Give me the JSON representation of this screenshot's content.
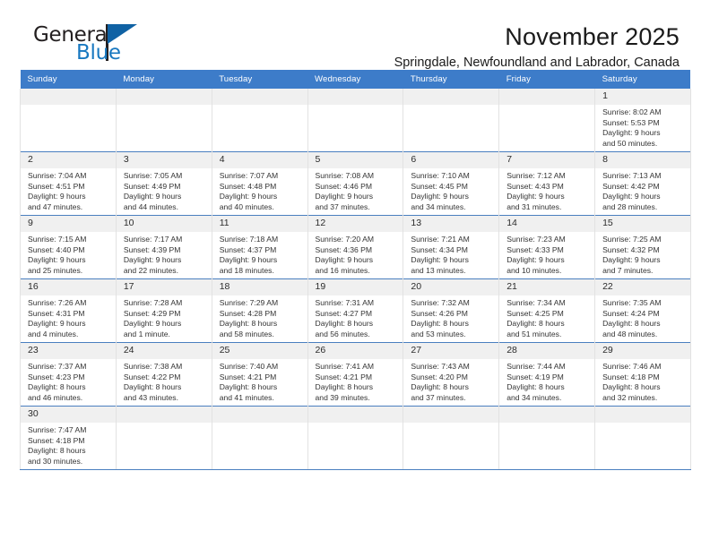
{
  "brand": {
    "name_top": "General",
    "name_bottom": "Blue",
    "accent_color": "#1878c0",
    "triangle_color": "#1062a4"
  },
  "header": {
    "title": "November 2025",
    "subtitle": "Springdale, Newfoundland and Labrador, Canada"
  },
  "calendar": {
    "header_bg": "#3d7cc9",
    "header_text_color": "#ffffff",
    "daynum_bg": "#f0f0f0",
    "row_separator_color": "#4a7fbf",
    "weekdays": [
      "Sunday",
      "Monday",
      "Tuesday",
      "Wednesday",
      "Thursday",
      "Friday",
      "Saturday"
    ],
    "weeks": [
      [
        {
          "day": "",
          "lines": []
        },
        {
          "day": "",
          "lines": []
        },
        {
          "day": "",
          "lines": []
        },
        {
          "day": "",
          "lines": []
        },
        {
          "day": "",
          "lines": []
        },
        {
          "day": "",
          "lines": []
        },
        {
          "day": "1",
          "lines": [
            "Sunrise: 8:02 AM",
            "Sunset: 5:53 PM",
            "Daylight: 9 hours",
            "and 50 minutes."
          ]
        }
      ],
      [
        {
          "day": "2",
          "lines": [
            "Sunrise: 7:04 AM",
            "Sunset: 4:51 PM",
            "Daylight: 9 hours",
            "and 47 minutes."
          ]
        },
        {
          "day": "3",
          "lines": [
            "Sunrise: 7:05 AM",
            "Sunset: 4:49 PM",
            "Daylight: 9 hours",
            "and 44 minutes."
          ]
        },
        {
          "day": "4",
          "lines": [
            "Sunrise: 7:07 AM",
            "Sunset: 4:48 PM",
            "Daylight: 9 hours",
            "and 40 minutes."
          ]
        },
        {
          "day": "5",
          "lines": [
            "Sunrise: 7:08 AM",
            "Sunset: 4:46 PM",
            "Daylight: 9 hours",
            "and 37 minutes."
          ]
        },
        {
          "day": "6",
          "lines": [
            "Sunrise: 7:10 AM",
            "Sunset: 4:45 PM",
            "Daylight: 9 hours",
            "and 34 minutes."
          ]
        },
        {
          "day": "7",
          "lines": [
            "Sunrise: 7:12 AM",
            "Sunset: 4:43 PM",
            "Daylight: 9 hours",
            "and 31 minutes."
          ]
        },
        {
          "day": "8",
          "lines": [
            "Sunrise: 7:13 AM",
            "Sunset: 4:42 PM",
            "Daylight: 9 hours",
            "and 28 minutes."
          ]
        }
      ],
      [
        {
          "day": "9",
          "lines": [
            "Sunrise: 7:15 AM",
            "Sunset: 4:40 PM",
            "Daylight: 9 hours",
            "and 25 minutes."
          ]
        },
        {
          "day": "10",
          "lines": [
            "Sunrise: 7:17 AM",
            "Sunset: 4:39 PM",
            "Daylight: 9 hours",
            "and 22 minutes."
          ]
        },
        {
          "day": "11",
          "lines": [
            "Sunrise: 7:18 AM",
            "Sunset: 4:37 PM",
            "Daylight: 9 hours",
            "and 18 minutes."
          ]
        },
        {
          "day": "12",
          "lines": [
            "Sunrise: 7:20 AM",
            "Sunset: 4:36 PM",
            "Daylight: 9 hours",
            "and 16 minutes."
          ]
        },
        {
          "day": "13",
          "lines": [
            "Sunrise: 7:21 AM",
            "Sunset: 4:34 PM",
            "Daylight: 9 hours",
            "and 13 minutes."
          ]
        },
        {
          "day": "14",
          "lines": [
            "Sunrise: 7:23 AM",
            "Sunset: 4:33 PM",
            "Daylight: 9 hours",
            "and 10 minutes."
          ]
        },
        {
          "day": "15",
          "lines": [
            "Sunrise: 7:25 AM",
            "Sunset: 4:32 PM",
            "Daylight: 9 hours",
            "and 7 minutes."
          ]
        }
      ],
      [
        {
          "day": "16",
          "lines": [
            "Sunrise: 7:26 AM",
            "Sunset: 4:31 PM",
            "Daylight: 9 hours",
            "and 4 minutes."
          ]
        },
        {
          "day": "17",
          "lines": [
            "Sunrise: 7:28 AM",
            "Sunset: 4:29 PM",
            "Daylight: 9 hours",
            "and 1 minute."
          ]
        },
        {
          "day": "18",
          "lines": [
            "Sunrise: 7:29 AM",
            "Sunset: 4:28 PM",
            "Daylight: 8 hours",
            "and 58 minutes."
          ]
        },
        {
          "day": "19",
          "lines": [
            "Sunrise: 7:31 AM",
            "Sunset: 4:27 PM",
            "Daylight: 8 hours",
            "and 56 minutes."
          ]
        },
        {
          "day": "20",
          "lines": [
            "Sunrise: 7:32 AM",
            "Sunset: 4:26 PM",
            "Daylight: 8 hours",
            "and 53 minutes."
          ]
        },
        {
          "day": "21",
          "lines": [
            "Sunrise: 7:34 AM",
            "Sunset: 4:25 PM",
            "Daylight: 8 hours",
            "and 51 minutes."
          ]
        },
        {
          "day": "22",
          "lines": [
            "Sunrise: 7:35 AM",
            "Sunset: 4:24 PM",
            "Daylight: 8 hours",
            "and 48 minutes."
          ]
        }
      ],
      [
        {
          "day": "23",
          "lines": [
            "Sunrise: 7:37 AM",
            "Sunset: 4:23 PM",
            "Daylight: 8 hours",
            "and 46 minutes."
          ]
        },
        {
          "day": "24",
          "lines": [
            "Sunrise: 7:38 AM",
            "Sunset: 4:22 PM",
            "Daylight: 8 hours",
            "and 43 minutes."
          ]
        },
        {
          "day": "25",
          "lines": [
            "Sunrise: 7:40 AM",
            "Sunset: 4:21 PM",
            "Daylight: 8 hours",
            "and 41 minutes."
          ]
        },
        {
          "day": "26",
          "lines": [
            "Sunrise: 7:41 AM",
            "Sunset: 4:21 PM",
            "Daylight: 8 hours",
            "and 39 minutes."
          ]
        },
        {
          "day": "27",
          "lines": [
            "Sunrise: 7:43 AM",
            "Sunset: 4:20 PM",
            "Daylight: 8 hours",
            "and 37 minutes."
          ]
        },
        {
          "day": "28",
          "lines": [
            "Sunrise: 7:44 AM",
            "Sunset: 4:19 PM",
            "Daylight: 8 hours",
            "and 34 minutes."
          ]
        },
        {
          "day": "29",
          "lines": [
            "Sunrise: 7:46 AM",
            "Sunset: 4:18 PM",
            "Daylight: 8 hours",
            "and 32 minutes."
          ]
        }
      ],
      [
        {
          "day": "30",
          "lines": [
            "Sunrise: 7:47 AM",
            "Sunset: 4:18 PM",
            "Daylight: 8 hours",
            "and 30 minutes."
          ]
        },
        {
          "day": "",
          "lines": []
        },
        {
          "day": "",
          "lines": []
        },
        {
          "day": "",
          "lines": []
        },
        {
          "day": "",
          "lines": []
        },
        {
          "day": "",
          "lines": []
        },
        {
          "day": "",
          "lines": []
        }
      ]
    ]
  }
}
